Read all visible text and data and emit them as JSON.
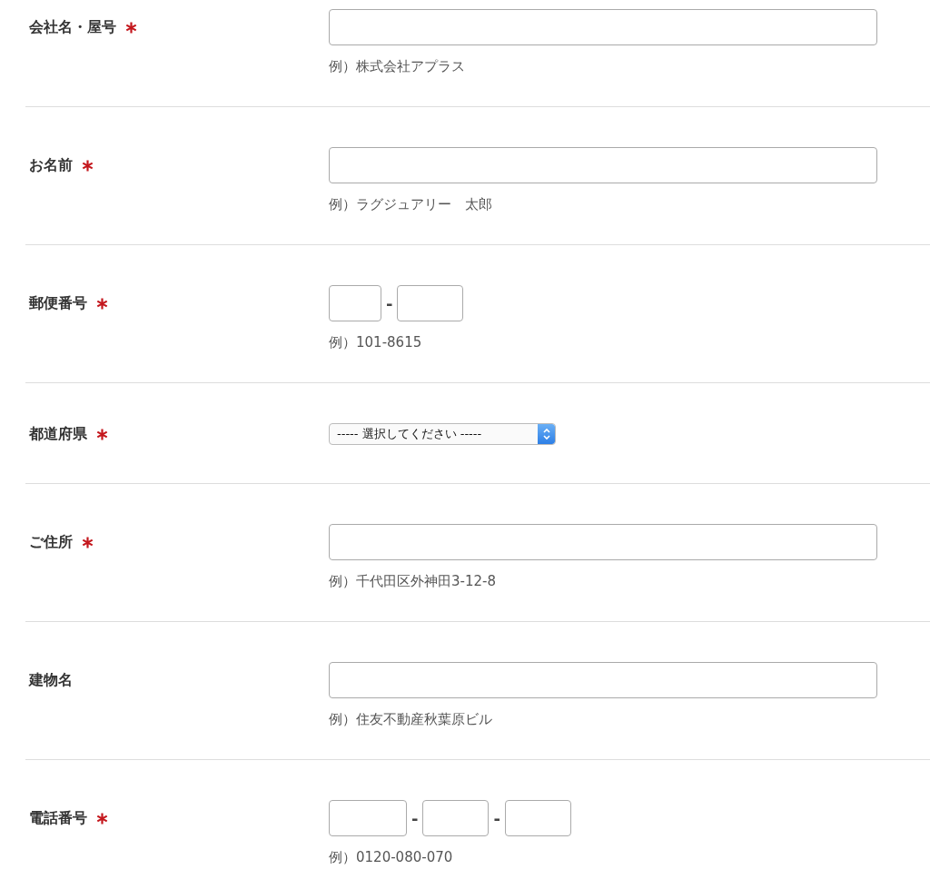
{
  "form": {
    "rows": [
      {
        "label": "会社名・屋号",
        "required": true,
        "kind": "text",
        "hint": "例）株式会社アプラス"
      },
      {
        "label": "お名前",
        "required": true,
        "kind": "text",
        "hint": "例）ラグジュアリー　太郎"
      },
      {
        "label": "郵便番号",
        "required": true,
        "kind": "postal",
        "separator": "-",
        "hint": "例）101-8615"
      },
      {
        "label": "都道府県",
        "required": true,
        "kind": "select",
        "value": "----- 選択してください -----"
      },
      {
        "label": "ご住所",
        "required": true,
        "kind": "text",
        "hint": "例）千代田区外神田3-12-8"
      },
      {
        "label": "建物名",
        "required": false,
        "kind": "text",
        "hint": "例）住友不動産秋葉原ビル"
      },
      {
        "label": "電話番号",
        "required": true,
        "kind": "phone",
        "separator": "-",
        "hint": "例）0120-080-070"
      }
    ]
  }
}
